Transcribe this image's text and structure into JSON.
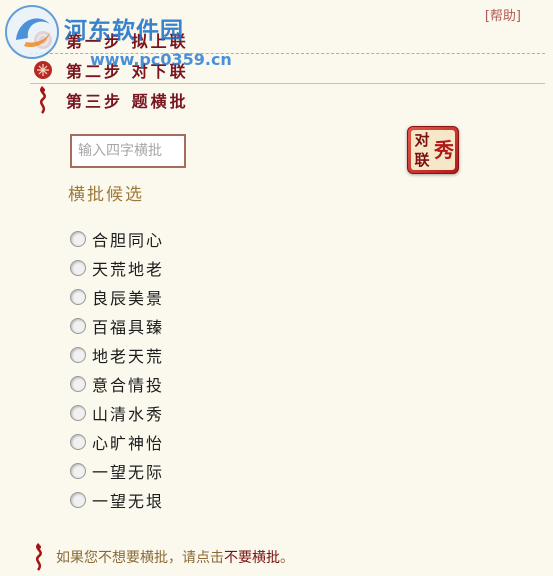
{
  "watermark": {
    "title": "河东软件园",
    "url": "www.pc0359.cn"
  },
  "help": {
    "label": "[帮助]"
  },
  "steps": [
    {
      "label": "第一步 拟上联"
    },
    {
      "label": "第二步 对下联"
    },
    {
      "label": "第三步 题横批"
    }
  ],
  "input": {
    "placeholder": "输入四字横批",
    "value": ""
  },
  "logo": {
    "chars": [
      "对",
      "秀",
      "联"
    ]
  },
  "candidates": {
    "title": "横批候选",
    "items": [
      "合胆同心",
      "天荒地老",
      "良辰美景",
      "百福具臻",
      "地老天荒",
      "意合情投",
      "山清水秀",
      "心旷神怡",
      "一望无际",
      "一望无垠"
    ]
  },
  "footer": {
    "text": "如果您不想要横批，请点击",
    "link": "不要横批",
    "end": "。"
  },
  "colors": {
    "background": "#fbf8ee",
    "step_text": "#7a1620",
    "accent_gold": "#9b7a3a",
    "help_link": "#b25a55"
  }
}
